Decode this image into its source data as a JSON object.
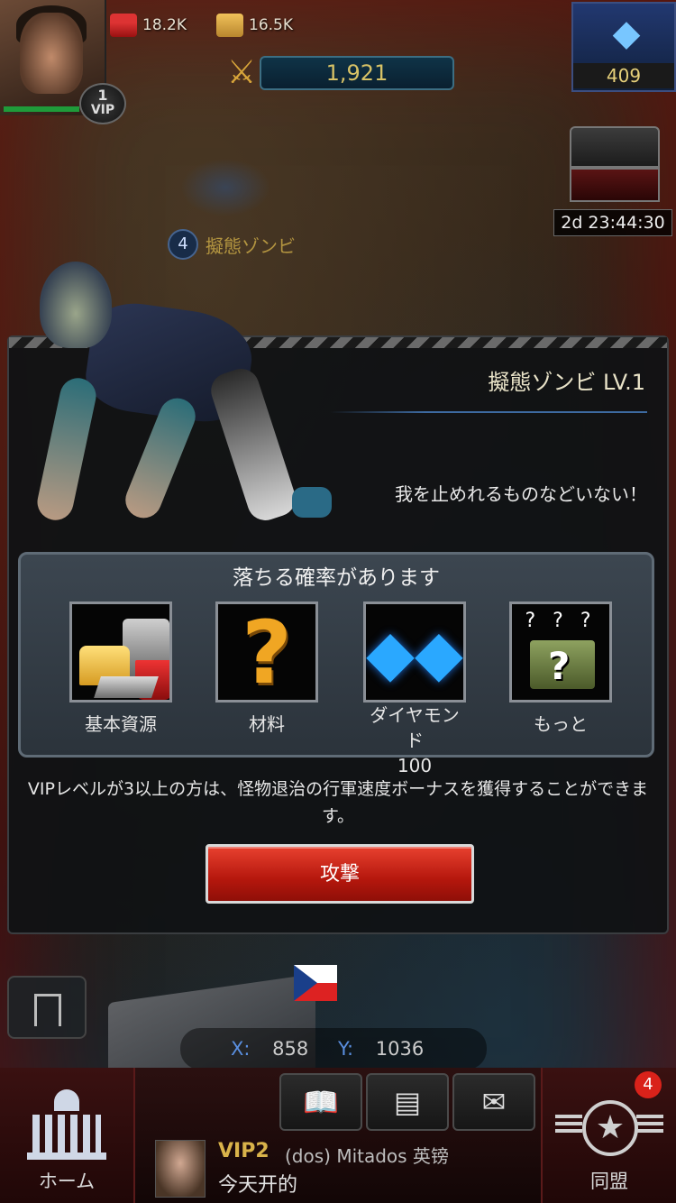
{
  "hud": {
    "food": "18.2K",
    "iron": "16.5K",
    "power": "1,921",
    "diamonds": "409",
    "vip_level": "1",
    "vip_label": "VIP",
    "event_timer": "2d 23:44:30"
  },
  "map": {
    "zombie_level": "4",
    "zombie_name": "擬態ゾンビ",
    "coord_x_label": "X:",
    "coord_x": "858",
    "coord_y_label": "Y:",
    "coord_y": "1036"
  },
  "modal": {
    "title": "擬態ゾンビ LV.1",
    "description": "我を止めれるものなどいない！",
    "drops_title": "落ちる確率があります",
    "drops": [
      {
        "label": "基本資源",
        "icon": "basic-resources-icon"
      },
      {
        "label": "材料",
        "icon": "question-mark-icon"
      },
      {
        "label": "ダイヤモンド\n100",
        "icon": "diamond-icon"
      },
      {
        "label": "もっと",
        "icon": "mystery-box-icon"
      }
    ],
    "drop_diamond_label": "ダイヤモンド",
    "drop_diamond_amount": "100",
    "vip_note": "VIPレベルが3以上の方は、怪物退治の行軍速度ボーナスを獲得することができます。",
    "attack_label": "攻撃"
  },
  "bottom_bar": {
    "home_label": "ホーム",
    "alliance_label": "同盟",
    "alliance_badge": "4",
    "chat": {
      "vip": "VIP2",
      "sender": "(dos) Mitados 英镑",
      "message": "今天开的"
    }
  },
  "colors": {
    "accent_gold": "#d9b34a",
    "attack_red": "#c21f12",
    "coord_blue": "#5a8fe0"
  }
}
